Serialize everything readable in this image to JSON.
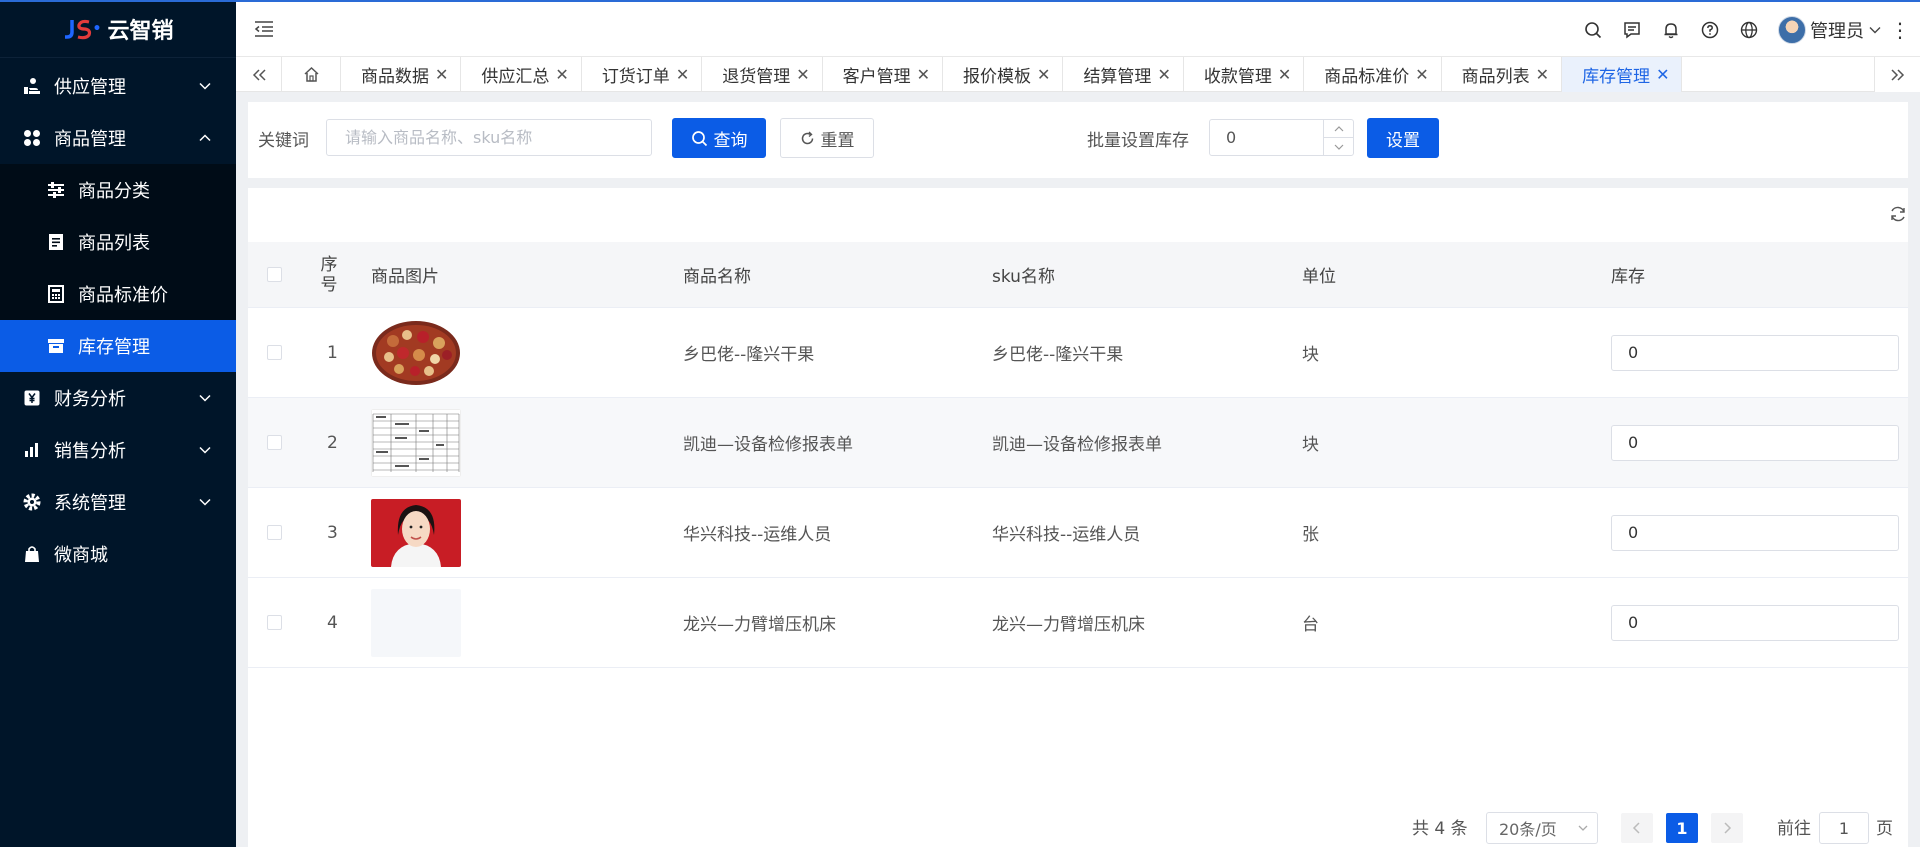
{
  "app": {
    "logo_text": "云智销"
  },
  "sidebar": {
    "items": [
      {
        "label": "供应管理",
        "icon": "supply-icon",
        "expanded": false
      },
      {
        "label": "商品管理",
        "icon": "goods-icon",
        "expanded": true,
        "children": [
          {
            "label": "商品分类",
            "icon": "sliders-icon"
          },
          {
            "label": "商品列表",
            "icon": "document-icon"
          },
          {
            "label": "商品标准价",
            "icon": "price-icon"
          },
          {
            "label": "库存管理",
            "icon": "inventory-icon",
            "active": true
          }
        ]
      },
      {
        "label": "财务分析",
        "icon": "yen-icon",
        "expanded": false
      },
      {
        "label": "销售分析",
        "icon": "bar-chart-icon",
        "expanded": false
      },
      {
        "label": "系统管理",
        "icon": "gear-icon",
        "expanded": false
      },
      {
        "label": "微商城",
        "icon": "shopping-bag-icon"
      }
    ]
  },
  "header": {
    "user_name": "管理员"
  },
  "tabs": [
    {
      "label": "商品数据"
    },
    {
      "label": "供应汇总"
    },
    {
      "label": "订货订单"
    },
    {
      "label": "退货管理"
    },
    {
      "label": "客户管理"
    },
    {
      "label": "报价模板"
    },
    {
      "label": "结算管理"
    },
    {
      "label": "收款管理"
    },
    {
      "label": "商品标准价"
    },
    {
      "label": "商品列表"
    },
    {
      "label": "库存管理",
      "active": true
    }
  ],
  "search": {
    "keyword_label": "关键词",
    "keyword_placeholder": "请输入商品名称、sku名称",
    "query_button": "查询",
    "reset_button": "重置",
    "batch_label": "批量设置库存",
    "batch_value": "0",
    "set_button": "设置"
  },
  "table": {
    "headers": {
      "seq": "序号",
      "image": "商品图片",
      "name": "商品名称",
      "sku": "sku名称",
      "unit": "单位",
      "stock": "库存"
    },
    "rows": [
      {
        "seq": "1",
        "image": "nuts-snack-image",
        "name": "乡巴佬--隆兴干果",
        "sku": "乡巴佬--隆兴干果",
        "unit": "块",
        "stock": "0"
      },
      {
        "seq": "2",
        "image": "inspection-form-image",
        "name": "凯迪—设备检修报表单",
        "sku": "凯迪—设备检修报表单",
        "unit": "块",
        "stock": "0"
      },
      {
        "seq": "3",
        "image": "staff-portrait-image",
        "name": "华兴科技--运维人员",
        "sku": "华兴科技--运维人员",
        "unit": "张",
        "stock": "0"
      },
      {
        "seq": "4",
        "image": "placeholder-image",
        "name": "龙兴—力臂增压机床",
        "sku": "龙兴—力臂增压机床",
        "unit": "台",
        "stock": "0"
      }
    ]
  },
  "pagination": {
    "total_text": "共 4 条",
    "page_size": "20条/页",
    "current_page": "1",
    "goto_prefix": "前往",
    "goto_value": "1",
    "goto_suffix": "页"
  },
  "colors": {
    "primary": "#0b5ce6",
    "sidebar_bg": "#001529",
    "active_tab_text": "#1f66e5"
  }
}
